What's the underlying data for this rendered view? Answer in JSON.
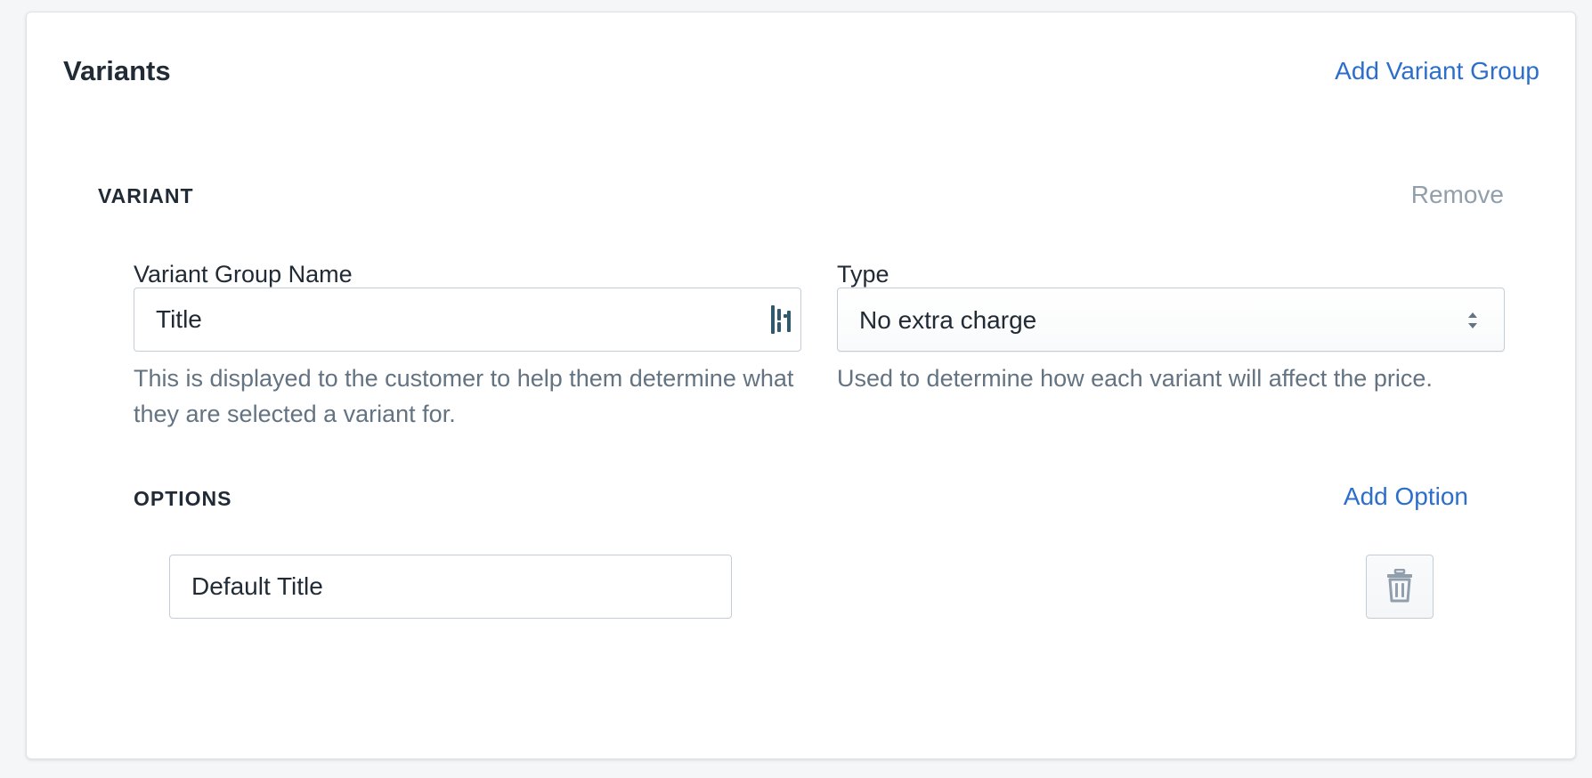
{
  "card": {
    "title": "Variants",
    "add_variant_group_label": "Add Variant Group"
  },
  "variant": {
    "heading": "VARIANT",
    "remove_label": "Remove",
    "name_field": {
      "label": "Variant Group Name",
      "value": "Title",
      "help": "This is displayed to the customer to help them determine what they are selected a variant for."
    },
    "type_field": {
      "label": "Type",
      "selected": "No extra charge",
      "help": "Used to determine how each variant will affect the price."
    },
    "options": {
      "heading": "OPTIONS",
      "add_option_label": "Add Option",
      "items": [
        {
          "value": "Default Title"
        }
      ]
    }
  },
  "icons": {
    "input_extension": "password-manager-icon",
    "select": "select-arrows-icon",
    "delete": "trash-icon"
  },
  "colors": {
    "link": "#2c6ecb",
    "muted": "#919eab",
    "help_text": "#637381",
    "border": "#c4cdd5"
  }
}
